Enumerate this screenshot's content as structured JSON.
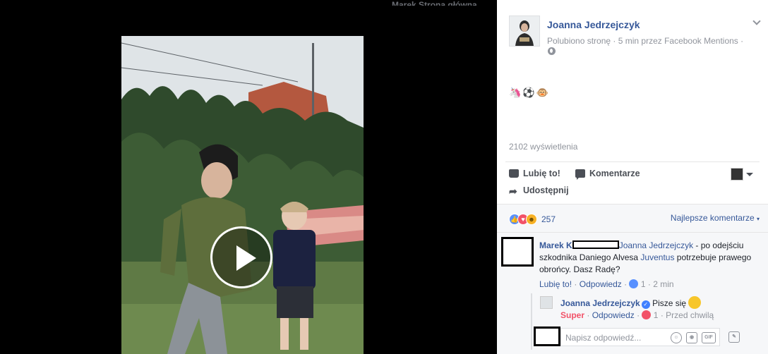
{
  "post": {
    "author": "Joanna Jedrzejczyk",
    "meta": "Polubiono stronę · 5 min przez Facebook Mentions ·",
    "emojis": "🦄⚽🐵",
    "views": "2102 wyświetlenia"
  },
  "actions": {
    "like": "Lubię to!",
    "comment": "Komentarze",
    "share": "Udostępnij"
  },
  "reactions": {
    "count": "257",
    "sort": "Najlepsze komentarze"
  },
  "comments": [
    {
      "author": "Marek K",
      "mention": "Joanna Jedrzejczyk",
      "text_1": " - po odejściu szkodnika Daniego Alvesa ",
      "link": "Juventus",
      "text_2": " potrzebuje prawego obrońcy. Dasz Radę?",
      "like": "Lubię to!",
      "reply": "Odpowiedz",
      "likes": "1",
      "time": "2 min"
    }
  ],
  "reply": {
    "author": "Joanna Jedrzejczyk",
    "text": "Pisze się",
    "react": "Super",
    "reply": "Odpowiedz",
    "likes": "1",
    "time": "Przed chwilą"
  },
  "reply_box": {
    "placeholder": "Napisz odpowiedź...",
    "gif": "GIF"
  },
  "top_strip": "Marek    Strona główna"
}
